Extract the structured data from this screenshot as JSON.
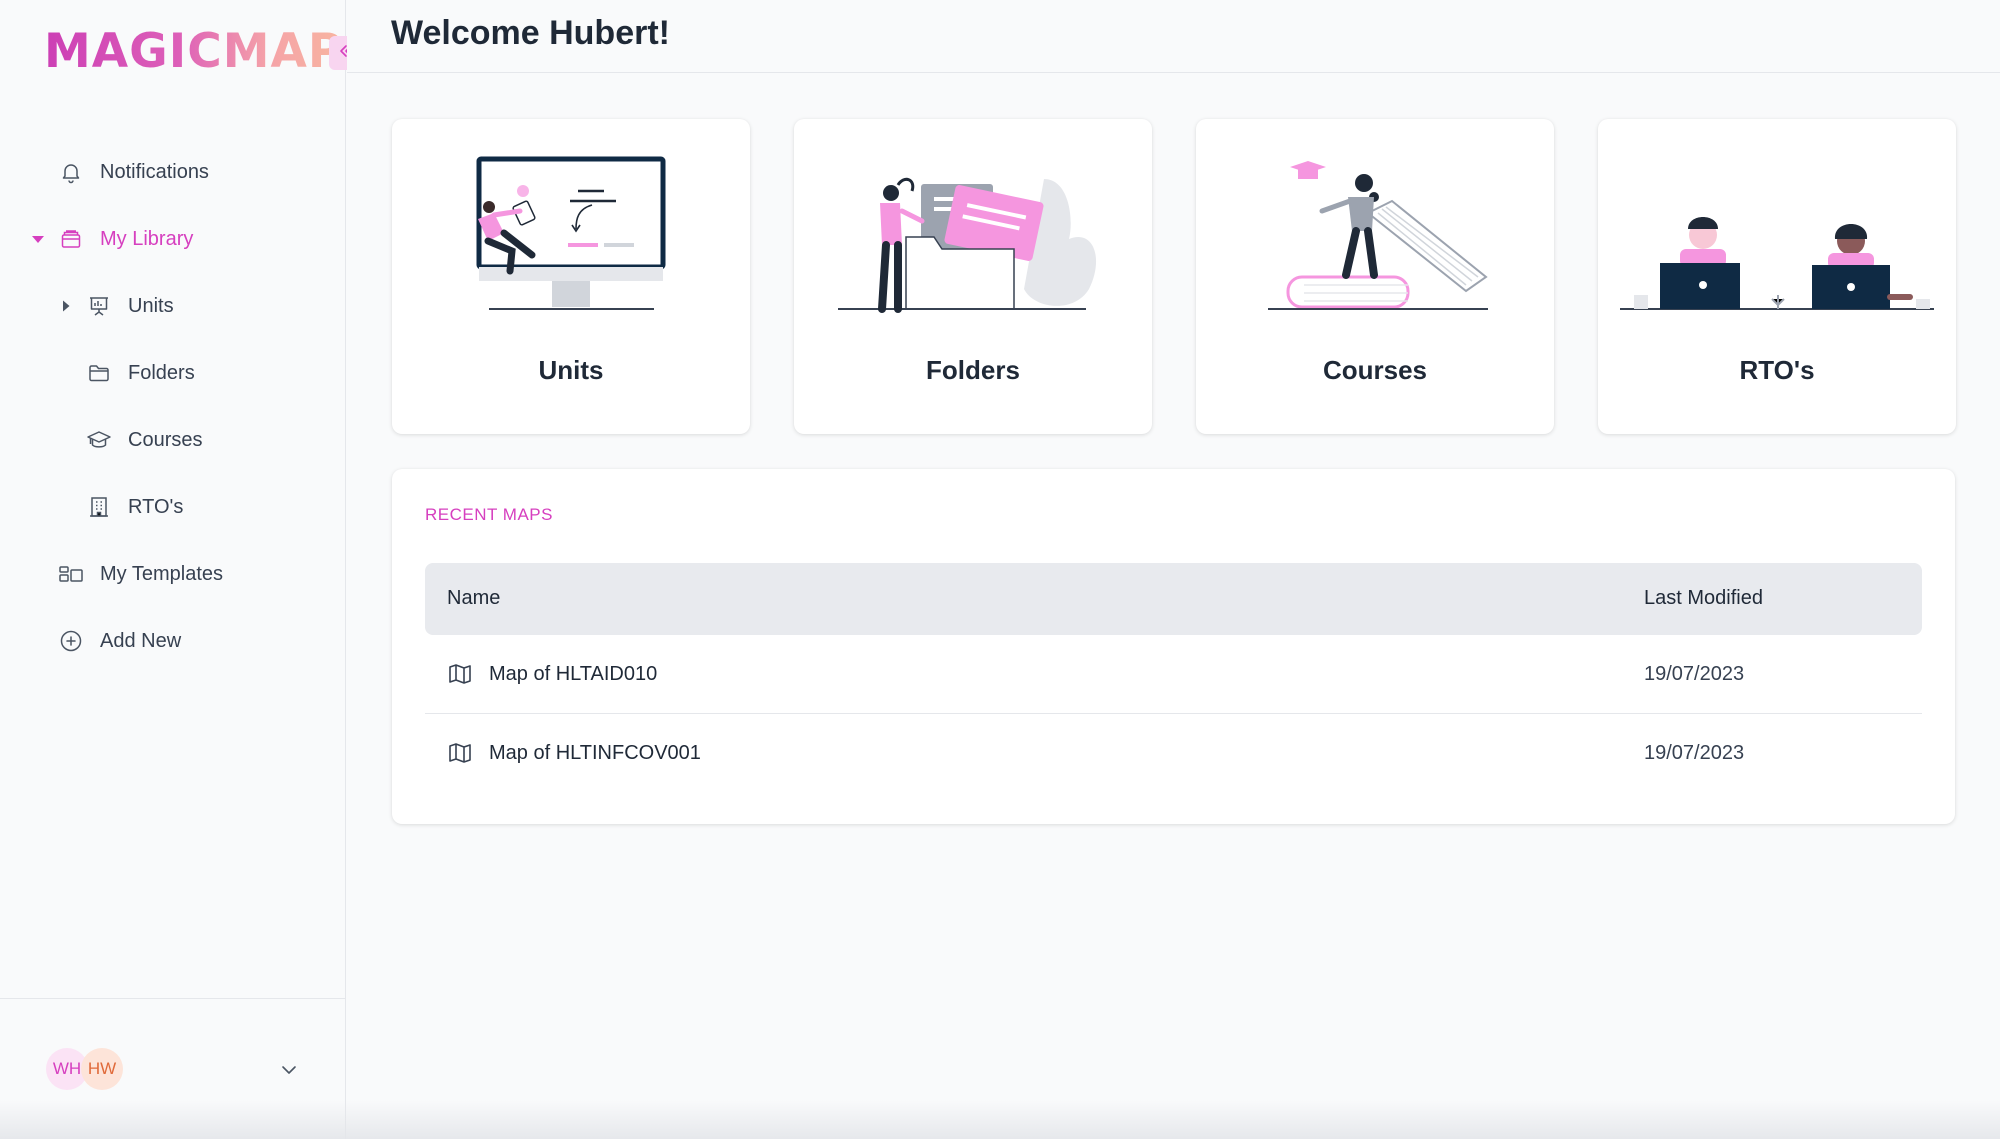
{
  "brand": {
    "logo_text": "MAGICMAP",
    "accent": "#d63fbf",
    "logo_gradient": [
      "#cc3fb5",
      "#f8b5a0"
    ]
  },
  "sidebar": {
    "collapse_icon": "double-chevron-left-icon",
    "items": [
      {
        "label": "Notifications",
        "icon": "bell-icon"
      },
      {
        "label": "My Library",
        "icon": "archive-box-icon",
        "active": true,
        "expanded": true
      },
      {
        "label": "Units",
        "icon": "presentation-board-icon",
        "collapsed_caret": true
      },
      {
        "label": "Folders",
        "icon": "folder-icon"
      },
      {
        "label": "Courses",
        "icon": "graduation-cap-icon"
      },
      {
        "label": "RTO's",
        "icon": "building-icon"
      },
      {
        "label": "My Templates",
        "icon": "layout-icon"
      },
      {
        "label": "Add New",
        "icon": "plus-circle-icon"
      }
    ],
    "user": {
      "avatars": [
        "WH",
        "HW"
      ],
      "dropdown_icon": "chevron-down-icon"
    }
  },
  "header": {
    "title": "Welcome Hubert!"
  },
  "cards": [
    {
      "label": "Units",
      "illustration": "person-at-monitor-illustration"
    },
    {
      "label": "Folders",
      "illustration": "person-with-folder-illustration"
    },
    {
      "label": "Courses",
      "illustration": "person-on-books-illustration"
    },
    {
      "label": "RTO's",
      "illustration": "people-at-laptops-illustration"
    }
  ],
  "recent_maps": {
    "title": "RECENT MAPS",
    "columns": [
      "Name",
      "Last Modified"
    ],
    "rows": [
      {
        "name": "Map of HLTAID010",
        "last_modified": "19/07/2023",
        "icon": "map-icon"
      },
      {
        "name": "Map of HLTINFCOV001",
        "last_modified": "19/07/2023",
        "icon": "map-icon"
      }
    ]
  }
}
